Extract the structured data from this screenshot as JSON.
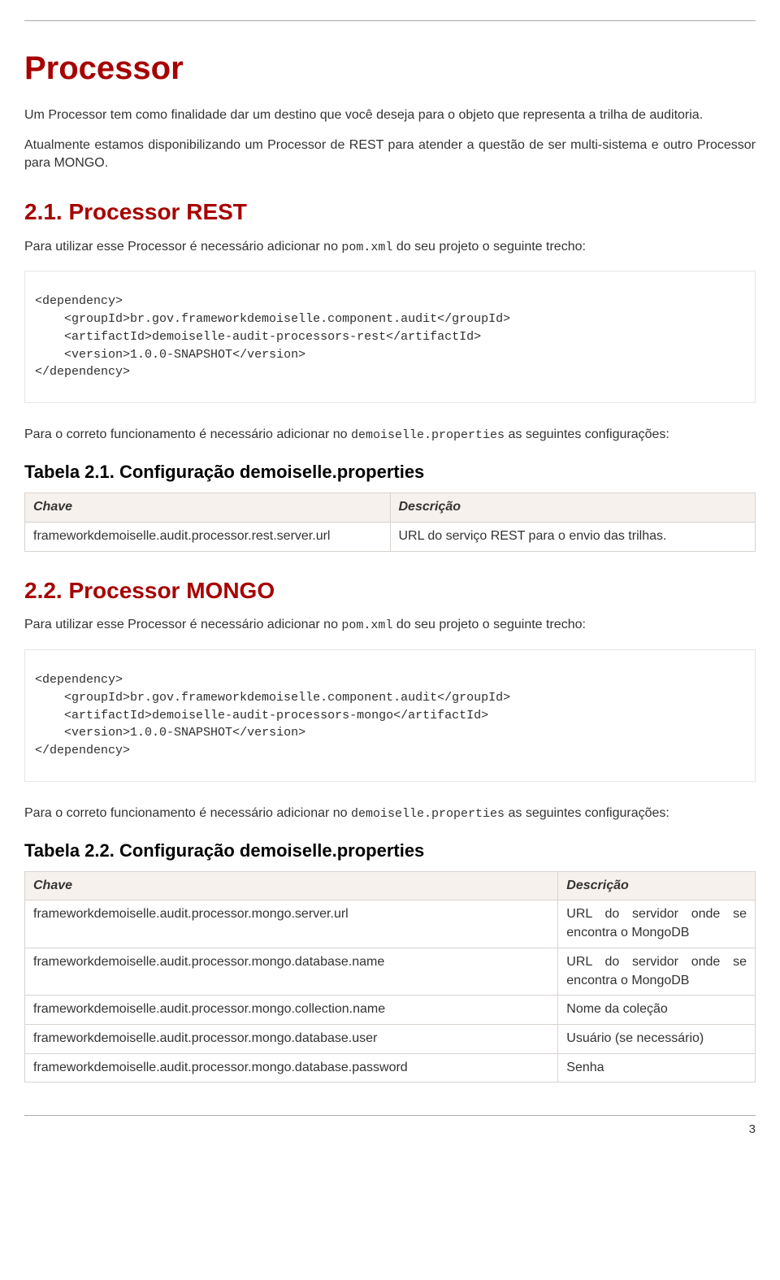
{
  "page": {
    "number": "3"
  },
  "chapter": {
    "title": "Processor",
    "intro_p1": "Um Processor tem como finalidade dar um destino que você deseja para o objeto que representa a trilha de auditoria.",
    "intro_p2": "Atualmente estamos disponibilizando um Processor de REST para atender a questão de ser multi-sistema e outro Processor para MONGO."
  },
  "sec1": {
    "title": "2.1. Processor REST",
    "p1_a": "Para utilizar esse Processor é necessário adicionar no ",
    "p1_file": "pom.xml",
    "p1_b": " do seu projeto o seguinte trecho:",
    "code": {
      "dep_open": "<dependency>",
      "group_open": "    <groupId>",
      "group_val": "br.gov.frameworkdemoiselle.component.audit",
      "group_close": "</groupId>",
      "artifact_open": "    <artifactId>",
      "artifact_val": "demoiselle-audit-processors-rest",
      "artifact_close": "</artifactId>",
      "version_open": "    <version>",
      "version_val": "1.0.0-SNAPSHOT",
      "version_close": "</version>",
      "dep_close": "</dependency>"
    },
    "p2_a": "Para o correto funcionamento é necessário adicionar no ",
    "p2_file": "demoiselle.properties",
    "p2_b": " as seguintes configurações:",
    "table_title": "Tabela 2.1. Configuração demoiselle.properties",
    "th_key": "Chave",
    "th_desc": "Descrição",
    "row_key": "frameworkdemoiselle.audit.processor.rest.server.url",
    "row_desc": "URL do serviço REST para o envio das trilhas."
  },
  "sec2": {
    "title": "2.2. Processor MONGO",
    "p1_a": "Para utilizar esse Processor é necessário adicionar no ",
    "p1_file": "pom.xml",
    "p1_b": " do seu projeto o seguinte trecho:",
    "code": {
      "dep_open": "<dependency>",
      "group_open": "    <groupId>",
      "group_val": "br.gov.frameworkdemoiselle.component.audit",
      "group_close": "</groupId>",
      "artifact_open": "    <artifactId>",
      "artifact_val": "demoiselle-audit-processors-mongo",
      "artifact_close": "</artifactId>",
      "version_open": "    <version>",
      "version_val": "1.0.0-SNAPSHOT",
      "version_close": "</version>",
      "dep_close": "</dependency>"
    },
    "p2_a": "Para o correto funcionamento é necessário adicionar no ",
    "p2_file": "demoiselle.properties",
    "p2_b": " as seguintes configurações:",
    "table_title": "Tabela 2.2. Configuração demoiselle.properties",
    "th_key": "Chave",
    "th_desc": "Descrição",
    "rows": [
      {
        "key": "frameworkdemoiselle.audit.processor.mongo.server.url",
        "desc": "URL do servidor onde se encontra o MongoDB"
      },
      {
        "key": "frameworkdemoiselle.audit.processor.mongo.database.name",
        "desc": "URL do servidor onde se encontra o MongoDB"
      },
      {
        "key": "frameworkdemoiselle.audit.processor.mongo.collection.name",
        "desc": "Nome da coleção"
      },
      {
        "key": "frameworkdemoiselle.audit.processor.mongo.database.user",
        "desc": "Usuário (se necessário)"
      },
      {
        "key": "frameworkdemoiselle.audit.processor.mongo.database.password",
        "desc": "Senha"
      }
    ]
  }
}
